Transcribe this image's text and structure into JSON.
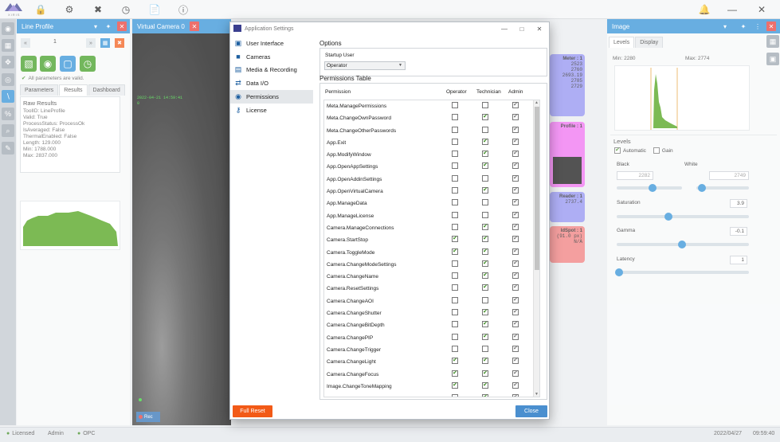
{
  "app": {
    "logo_text": "XIRIS"
  },
  "left_panel": {
    "title": "Line Profile",
    "nav_value": "1",
    "valid_text": "All parameters are valid.",
    "tabs": [
      "Parameters",
      "Results",
      "Dashboard"
    ],
    "selected_tab": "Results",
    "raw_title": "Raw Results",
    "raw_lines": [
      "ToolID: LineProfile",
      "Valid: True",
      "ProcessStatus: ProcessOk",
      "IsAveraged: False",
      "ThermalEnabled: False",
      "Length: 129.000",
      "Min: 1788.000",
      "Max: 2837.000"
    ]
  },
  "camera_panel": {
    "title": "Virtual Camera 0",
    "timestamp": "2022-04-21 14:59:41",
    "sub": "0",
    "rec_label": "Rec"
  },
  "bg_cards": [
    {
      "title": "Meter : 1",
      "values": [
        "2523",
        "2760",
        "2693.19",
        "2785",
        "2729"
      ],
      "color": "#8f8ff0"
    },
    {
      "title": "Profile : 1",
      "values": [],
      "color": "#ef6ef0"
    },
    {
      "title": "Reader : 1",
      "values": [
        "2737.4"
      ],
      "color": "#8f8ff0"
    },
    {
      "title": "ldSpot : 1",
      "values": [
        "(91.0 px)",
        "N/A"
      ],
      "color": "#f07a7a"
    }
  ],
  "image_panel": {
    "title": "Image",
    "tabs": [
      "Levels",
      "Display"
    ],
    "min_label": "Min: 2280",
    "max_label": "Max: 2774",
    "levels_title": "Levels",
    "automatic_label": "Automatic",
    "gain_label": "Gain",
    "black_label": "Black",
    "white_label": "White",
    "black_value": "2282",
    "white_value": "2749",
    "saturation_label": "Saturation",
    "saturation_value": "3.9",
    "gamma_label": "Gamma",
    "gamma_value": "-0.1",
    "latency_label": "Latency",
    "latency_value": "1"
  },
  "status_bar": {
    "licensed": "Licensed",
    "user": "Admin",
    "opc": "OPC",
    "date": "2022/04/27",
    "time": "09:59:40"
  },
  "dialog": {
    "title": "Application Settings",
    "nav": [
      {
        "label": "User Interface",
        "icon": "monitor-icon"
      },
      {
        "label": "Cameras",
        "icon": "camera-icon"
      },
      {
        "label": "Media & Recording",
        "icon": "film-icon"
      },
      {
        "label": "Data I/O",
        "icon": "transfer-icon"
      },
      {
        "label": "Permissions",
        "icon": "lock-icon"
      },
      {
        "label": "License",
        "icon": "key-icon"
      }
    ],
    "selected_nav": "Permissions",
    "options_title": "Options",
    "startup_label": "Startup User",
    "startup_value": "Operator",
    "perm_title": "Permissions Table",
    "columns": [
      "Permission",
      "Operator",
      "Technician",
      "Admin"
    ],
    "permissions": [
      {
        "name": "Meta.ManagePermissions",
        "op": false,
        "tech": false,
        "admin": true
      },
      {
        "name": "Meta.ChangeOwnPassword",
        "op": false,
        "tech": true,
        "admin": true
      },
      {
        "name": "Meta.ChangeOtherPasswords",
        "op": false,
        "tech": false,
        "admin": true
      },
      {
        "name": "App.Exit",
        "op": false,
        "tech": true,
        "admin": true
      },
      {
        "name": "App.ModifyWindow",
        "op": false,
        "tech": true,
        "admin": true
      },
      {
        "name": "App.OpenAppSettings",
        "op": false,
        "tech": true,
        "admin": true
      },
      {
        "name": "App.OpenAddinSettings",
        "op": false,
        "tech": false,
        "admin": true
      },
      {
        "name": "App.OpenVirtualCamera",
        "op": false,
        "tech": true,
        "admin": true
      },
      {
        "name": "App.ManageData",
        "op": false,
        "tech": false,
        "admin": true
      },
      {
        "name": "App.ManageLicense",
        "op": false,
        "tech": false,
        "admin": true
      },
      {
        "name": "Camera.ManageConnections",
        "op": false,
        "tech": true,
        "admin": true
      },
      {
        "name": "Camera.StartStop",
        "op": true,
        "tech": true,
        "admin": true
      },
      {
        "name": "Camera.ToggleMode",
        "op": true,
        "tech": true,
        "admin": true
      },
      {
        "name": "Camera.ChangeModeSettings",
        "op": false,
        "tech": true,
        "admin": true
      },
      {
        "name": "Camera.ChangeName",
        "op": false,
        "tech": true,
        "admin": true
      },
      {
        "name": "Camera.ResetSettings",
        "op": false,
        "tech": true,
        "admin": true
      },
      {
        "name": "Camera.ChangeAOI",
        "op": false,
        "tech": false,
        "admin": true
      },
      {
        "name": "Camera.ChangeShutter",
        "op": false,
        "tech": true,
        "admin": true
      },
      {
        "name": "Camera.ChangeBitDepth",
        "op": false,
        "tech": true,
        "admin": true
      },
      {
        "name": "Camera.ChangePIP",
        "op": false,
        "tech": true,
        "admin": true
      },
      {
        "name": "Camera.ChangeTrigger",
        "op": false,
        "tech": false,
        "admin": true
      },
      {
        "name": "Camera.ChangeLight",
        "op": true,
        "tech": true,
        "admin": true
      },
      {
        "name": "Camera.ChangeFocus",
        "op": true,
        "tech": true,
        "admin": true
      },
      {
        "name": "Image.ChangeToneMapping",
        "op": true,
        "tech": true,
        "admin": true
      },
      {
        "name": "",
        "op": false,
        "tech": true,
        "admin": true
      }
    ],
    "reset_label": "Full Reset",
    "close_label": "Close"
  }
}
